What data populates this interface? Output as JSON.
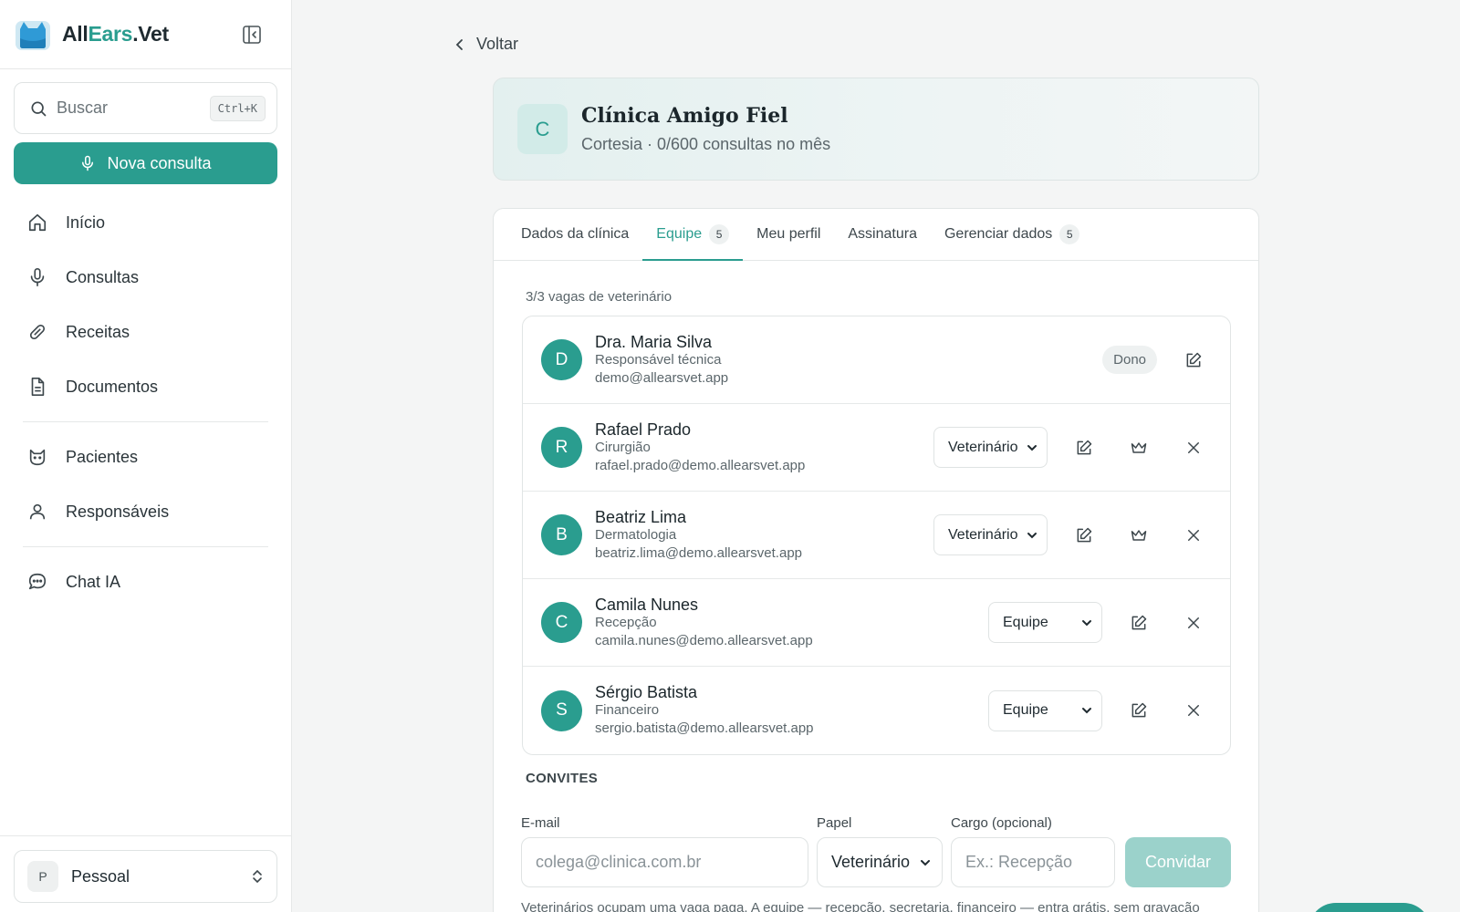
{
  "brand": {
    "part1": "All",
    "part2": "Ears",
    "part3": ".Vet"
  },
  "search": {
    "placeholder": "Buscar",
    "shortcut": "Ctrl+K"
  },
  "new_consult_label": "Nova consulta",
  "nav": {
    "items": [
      {
        "label": "Início",
        "icon": "home-icon"
      },
      {
        "label": "Consultas",
        "icon": "microphone-icon"
      },
      {
        "label": "Receitas",
        "icon": "pill-icon"
      },
      {
        "label": "Documentos",
        "icon": "document-icon"
      },
      {
        "label": "Pacientes",
        "icon": "cat-icon"
      },
      {
        "label": "Responsáveis",
        "icon": "user-icon"
      },
      {
        "label": "Chat IA",
        "icon": "chat-icon"
      }
    ]
  },
  "profile": {
    "initial": "P",
    "name": "Pessoal"
  },
  "back_label": "Voltar",
  "clinic": {
    "initial": "C",
    "name": "Clínica Amigo Fiel",
    "subtitle": "Cortesia · 0/600 consultas no mês"
  },
  "tabs": [
    {
      "label": "Dados da clínica"
    },
    {
      "label": "Equipe",
      "badge": "5",
      "active": true
    },
    {
      "label": "Meu perfil"
    },
    {
      "label": "Assinatura"
    },
    {
      "label": "Gerenciar dados",
      "badge": "5"
    }
  ],
  "slots_text": "3/3 vagas de veterinário",
  "members": [
    {
      "initial": "D",
      "name": "Dra. Maria Silva",
      "role": "Responsável técnica",
      "email": "demo@allearsvet.app",
      "badge": "Dono"
    },
    {
      "initial": "R",
      "name": "Rafael Prado",
      "role": "Cirurgião",
      "email": "rafael.prado@demo.allearsvet.app",
      "access": "Veterinário"
    },
    {
      "initial": "B",
      "name": "Beatriz Lima",
      "role": "Dermatologia",
      "email": "beatriz.lima@demo.allearsvet.app",
      "access": "Veterinário"
    },
    {
      "initial": "C",
      "name": "Camila Nunes",
      "role": "Recepção",
      "email": "camila.nunes@demo.allearsvet.app",
      "access": "Equipe"
    },
    {
      "initial": "S",
      "name": "Sérgio Batista",
      "role": "Financeiro",
      "email": "sergio.batista@demo.allearsvet.app",
      "access": "Equipe"
    }
  ],
  "invites": {
    "title": "CONVITES",
    "email_label": "E-mail",
    "email_placeholder": "colega@clinica.com.br",
    "role_label": "Papel",
    "role_value": "Veterinário",
    "position_label": "Cargo (opcional)",
    "position_placeholder": "Ex.: Recepção",
    "button": "Convidar",
    "note": "Veterinários ocupam uma vaga paga. A equipe — recepção, secretaria, financeiro — entra grátis, sem gravação"
  },
  "colors": {
    "accent": "#2a9d8f",
    "accent_light": "#9bd2cb"
  }
}
